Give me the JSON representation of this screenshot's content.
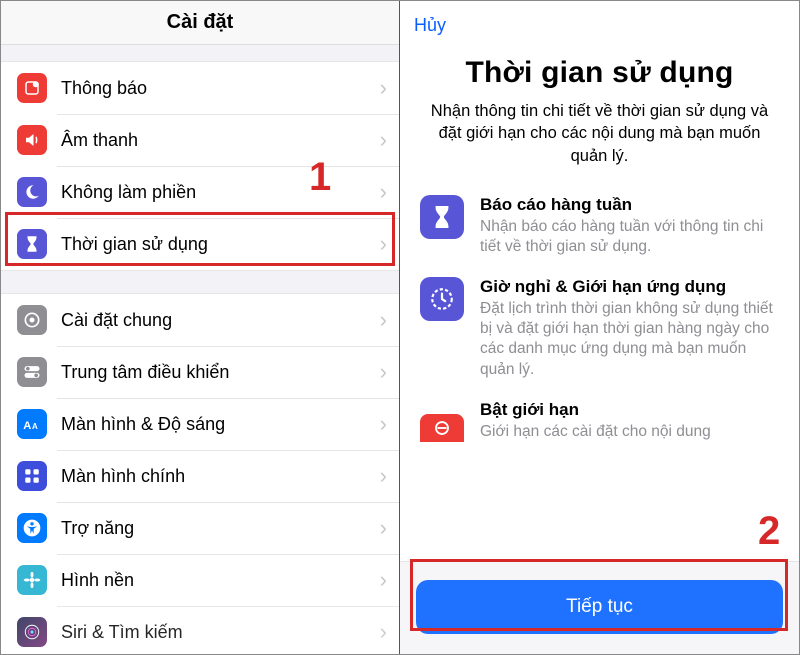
{
  "left": {
    "title": "Cài đặt",
    "group1": [
      {
        "icon": "notify",
        "label": "Thông báo"
      },
      {
        "icon": "sound",
        "label": "Âm thanh"
      },
      {
        "icon": "dnd",
        "label": "Không làm phiền"
      },
      {
        "icon": "screentime",
        "label": "Thời gian sử dụng"
      }
    ],
    "group2": [
      {
        "icon": "general",
        "label": "Cài đặt chung"
      },
      {
        "icon": "control",
        "label": "Trung tâm điều khiển"
      },
      {
        "icon": "display",
        "label": "Màn hình & Độ sáng"
      },
      {
        "icon": "home",
        "label": "Màn hình chính"
      },
      {
        "icon": "access",
        "label": "Trợ năng"
      },
      {
        "icon": "wall",
        "label": "Hình nền"
      },
      {
        "icon": "siri",
        "label": "Siri & Tìm kiếm"
      }
    ]
  },
  "right": {
    "cancel": "Hủy",
    "title": "Thời gian sử dụng",
    "subtitle": "Nhận thông tin chi tiết về thời gian sử dụng và đặt giới hạn cho các nội dung mà bạn muốn quản lý.",
    "features": [
      {
        "icon": "hourglass",
        "color": "purple",
        "title": "Báo cáo hàng tuần",
        "desc": "Nhận báo cáo hàng tuần với thông tin chi tiết về thời gian sử dụng."
      },
      {
        "icon": "clock",
        "color": "purple",
        "title": "Giờ nghỉ & Giới hạn ứng dụng",
        "desc": "Đặt lịch trình thời gian không sử dụng thiết bị và đặt giới hạn thời gian hàng ngày cho các danh mục ứng dụng mà bạn muốn quản lý."
      },
      {
        "icon": "restrict",
        "color": "red",
        "title": "Bật giới hạn",
        "desc": "Giới hạn các cài đặt cho nội dung"
      }
    ],
    "continue": "Tiếp tục"
  },
  "callouts": {
    "one": "1",
    "two": "2"
  }
}
